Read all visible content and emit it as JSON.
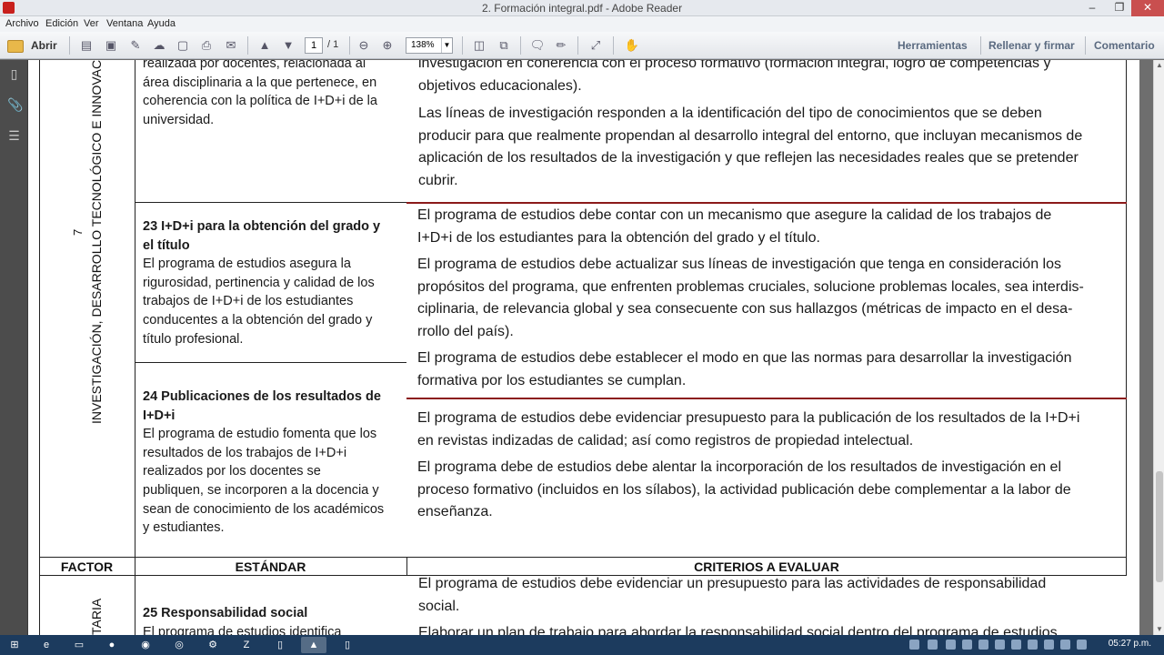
{
  "window": {
    "title": "2. Formación integral.pdf - Adobe Reader"
  },
  "menu": [
    "Archivo",
    "Edición",
    "Ver",
    "Ventana",
    "Ayuda"
  ],
  "toolbar": {
    "open_label": "Abrir",
    "page_current": "1",
    "page_total": "/ 1",
    "zoom": "138%",
    "tools_label": "Herramientas",
    "fill_sign_label": "Rellenar y firmar",
    "comment_label": "Comentario"
  },
  "document": {
    "factor_vertical": "INVESTIGACIÓN, DESARROLLO TECNOLÓGICO E INNOVACIÓN",
    "factor_number": "7",
    "rows": [
      {
        "std_lines": [
          "realizada por docentes, relacionada al",
          "área disciplinaria a la que pertenece, en",
          "coherencia con la política de I+D+i de la",
          "universidad."
        ],
        "crit_lines": [
          "investigación en coherencia con el proceso formativo (formación integral, logro de competencias y",
          "objetivos educacionales).",
          "Las líneas de investigación responden a la identificación del tipo de conocimientos que se deben",
          "producir para que realmente propendan al desarrollo integral del entorno, que incluyan mecanismos de",
          "aplicación de los resultados de la investigación y que reflejen las necesidades reales que se pretender",
          "cubrir."
        ]
      },
      {
        "std_title": [
          "23 I+D+i para la obtención del grado y",
          "el título"
        ],
        "std_lines": [
          "El programa de estudios asegura la",
          "rigurosidad, pertinencia y calidad de los",
          "trabajos de I+D+i de los estudiantes",
          "conducentes a la obtención del grado y",
          "título profesional."
        ],
        "crit_lines": [
          "El programa de estudios debe contar con un mecanismo que asegure la calidad de los trabajos de",
          "I+D+i de los estudiantes para la obtención del grado y el título.",
          "El programa de estudios debe actualizar sus líneas de investigación que tenga en consideración los",
          "propósitos del programa, que enfrenten problemas cruciales, solucione problemas locales, sea interdis-",
          "ciplinaria, de relevancia global y sea consecuente con sus hallazgos (métricas de impacto en el desa-",
          "rrollo del país).",
          "El programa de estudios debe establecer el modo en que las normas para desarrollar la investigación",
          "formativa por los estudiantes se cumplan."
        ]
      },
      {
        "std_title": [
          "24 Publicaciones de los resultados de",
          "I+D+i"
        ],
        "std_lines": [
          "El programa de estudio fomenta que los",
          "resultados de los trabajos de I+D+i",
          "realizados por los docentes se",
          "publiquen, se incorporen a la docencia y",
          "sean de conocimiento de los académicos",
          "y estudiantes."
        ],
        "crit_lines": [
          "El programa de estudios debe evidenciar presupuesto para la publicación de los resultados de la I+D+i",
          "en revistas indizadas de calidad; así como registros de propiedad intelectual.",
          "El programa debe de estudios debe alentar la incorporación de los resultados de investigación en el",
          "proceso formativo (incluidos en los sílabos), la actividad publicación debe complementar a la labor de",
          "enseñanza."
        ]
      }
    ],
    "header": {
      "factor": "FACTOR",
      "standard": "ESTÁNDAR",
      "criteria": "CRITERIOS A EVALUAR"
    },
    "next_factor_partial": "TARIA",
    "next_row": {
      "std_title": "25 Responsabilidad social",
      "std_partial": "El programa de estudios identifica",
      "crit_lines": [
        "El programa de estudios debe evidenciar un presupuesto para las actividades de responsabilidad",
        "social.",
        "Elaborar un plan de trabajo para abordar la responsabilidad social dentro del programa de estudios"
      ]
    }
  },
  "taskbar": {
    "clock": "05:27 p.m."
  }
}
